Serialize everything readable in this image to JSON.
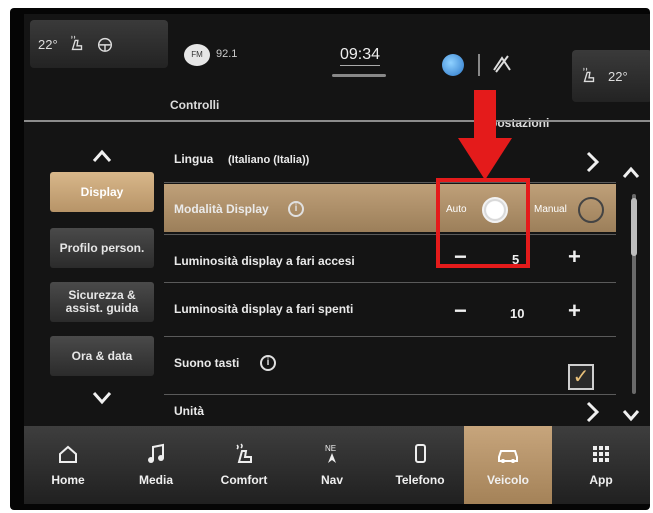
{
  "status_bar": {
    "temp_left": "22°",
    "temp_right": "22°",
    "radio_band": "FM",
    "radio_freq": "92.1",
    "clock": "09:34"
  },
  "tabs": {
    "controlli": "Controlli",
    "impostazioni": "Impostazioni",
    "impostazioni_visible": "postazioni"
  },
  "side_menu": {
    "items": [
      {
        "label": "Display",
        "active": true
      },
      {
        "label": "Profilo person.",
        "active": false
      },
      {
        "label": "Sicurezza & assist. guida",
        "active": false
      },
      {
        "label": "Ora & data",
        "active": false
      }
    ]
  },
  "settings": {
    "lingua": {
      "label": "Lingua",
      "value": "(Italiano (Italia))"
    },
    "modalita": {
      "label": "Modalità Display",
      "options": [
        "Auto",
        "Manual"
      ],
      "selected": "Auto"
    },
    "lum_accesi": {
      "label": "Luminosità display a fari accesi",
      "value": "5"
    },
    "lum_spenti": {
      "label": "Luminosità display a fari spenti",
      "value": "10"
    },
    "suono_tasti": {
      "label": "Suono tasti",
      "checked": true
    },
    "unita": {
      "label": "Unità"
    }
  },
  "stepper": {
    "minus": "−",
    "plus": "+"
  },
  "bottom_nav": {
    "items": [
      {
        "label": "Home",
        "icon": "home-icon"
      },
      {
        "label": "Media",
        "icon": "music-note-icon"
      },
      {
        "label": "Comfort",
        "icon": "seat-heat-icon"
      },
      {
        "label": "Nav",
        "icon": "compass-icon"
      },
      {
        "label": "Telefono",
        "icon": "phone-icon"
      },
      {
        "label": "Veicolo",
        "icon": "car-icon"
      },
      {
        "label": "App",
        "icon": "grid-icon"
      }
    ],
    "active": "Veicolo"
  },
  "colors": {
    "accent_active": "#c7a57c",
    "highlight_red": "#e41b1b"
  }
}
